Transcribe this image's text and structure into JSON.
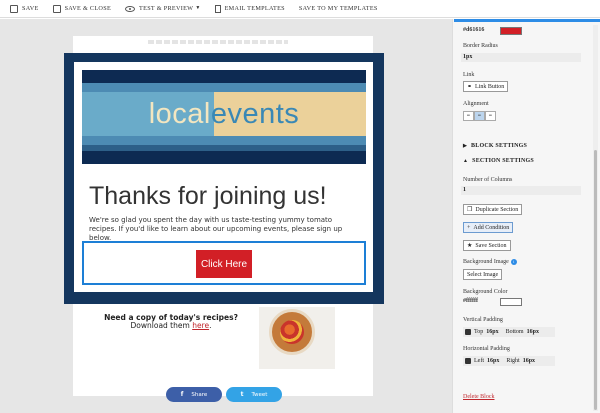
{
  "toolbar": {
    "save": "SAVE",
    "save_close": "SAVE & CLOSE",
    "test_preview": "TEST & PREVIEW",
    "email_templates": "EMAIL TEMPLATES",
    "save_to_templates": "SAVE TO MY TEMPLATES"
  },
  "email": {
    "banner_word1": "local",
    "banner_word2": "events",
    "headline": "Thanks for joining us!",
    "body": "We're so glad you spent the day with us taste-testing yummy tomato recipes. If you'd like to learn about our upcoming events, please sign up below.",
    "cta": "Click Here",
    "copy_heading": "Need a copy of today's recipes?",
    "copy_prefix": "Download them ",
    "copy_link": "here",
    "copy_suffix": ".",
    "share": "Share",
    "tweet": "Tweet",
    "share_icon": "f",
    "tweet_icon": "t"
  },
  "panel": {
    "color_value": "#d61616",
    "color_swatch": "#d21f26",
    "border_radius_label": "Border Radius",
    "border_radius_value": "1px",
    "link_label": "Link",
    "link_button": "Link Button",
    "alignment_label": "Alignment",
    "block_settings": "BLOCK SETTINGS",
    "section_settings": "SECTION SETTINGS",
    "num_columns_label": "Number of Columns",
    "num_columns_value": "1",
    "duplicate_section": "Duplicate Section",
    "add_condition": "Add Condition",
    "save_section": "Save Section",
    "bg_image_label": "Background Image",
    "select_image": "Select Image",
    "bg_color_label": "Background Color",
    "bg_color_value": "#ffffff",
    "vertical_padding_label": "Vertical Padding",
    "top_label": "Top",
    "top_value": "16px",
    "bottom_label": "Bottom",
    "bottom_value": "16px",
    "horizontal_padding_label": "Horizontal Padding",
    "left_label": "Left",
    "left_value": "16px",
    "right_label": "Right",
    "right_value": "16px",
    "delete_block": "Delete Block"
  }
}
